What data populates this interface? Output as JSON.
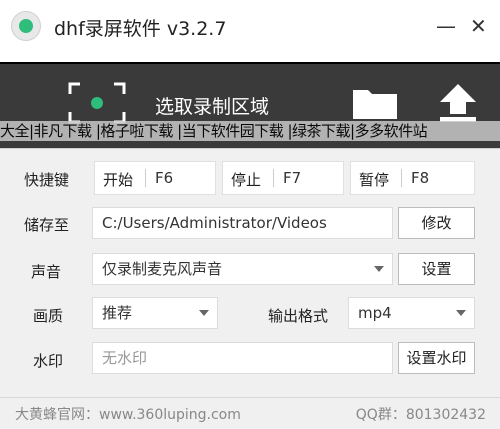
{
  "window": {
    "title": "dhf录屏软件 v3.2.7",
    "minimize": "—",
    "close": "✕"
  },
  "toolbar": {
    "capture_label": "选取录制区域",
    "overlay_text": "大全|非凡下载 |格子啦下载 |当下软件园下载 |绿茶下载|多多软件站"
  },
  "hotkeys": {
    "label": "快捷键",
    "start": {
      "name": "开始",
      "key": "F6"
    },
    "stop": {
      "name": "停止",
      "key": "F7"
    },
    "pause": {
      "name": "暂停",
      "key": "F8"
    }
  },
  "save": {
    "label": "储存至",
    "path": "C:/Users/Administrator/Videos",
    "button": "修改"
  },
  "audio": {
    "label": "声音",
    "selected": "仅录制麦克风声音",
    "button": "设置"
  },
  "quality": {
    "label": "画质",
    "selected": "推荐"
  },
  "format": {
    "label": "输出格式",
    "selected": "mp4"
  },
  "watermark": {
    "label": "水印",
    "value": "无水印",
    "button": "设置水印"
  },
  "footer": {
    "site": "大黄蜂官网：www.360luping.com",
    "qq": "QQ群：801302432"
  },
  "colors": {
    "accent": "#2ebd7a",
    "toolbar_bg": "#3a3a3a",
    "panel_bg": "#f0f0f0"
  }
}
